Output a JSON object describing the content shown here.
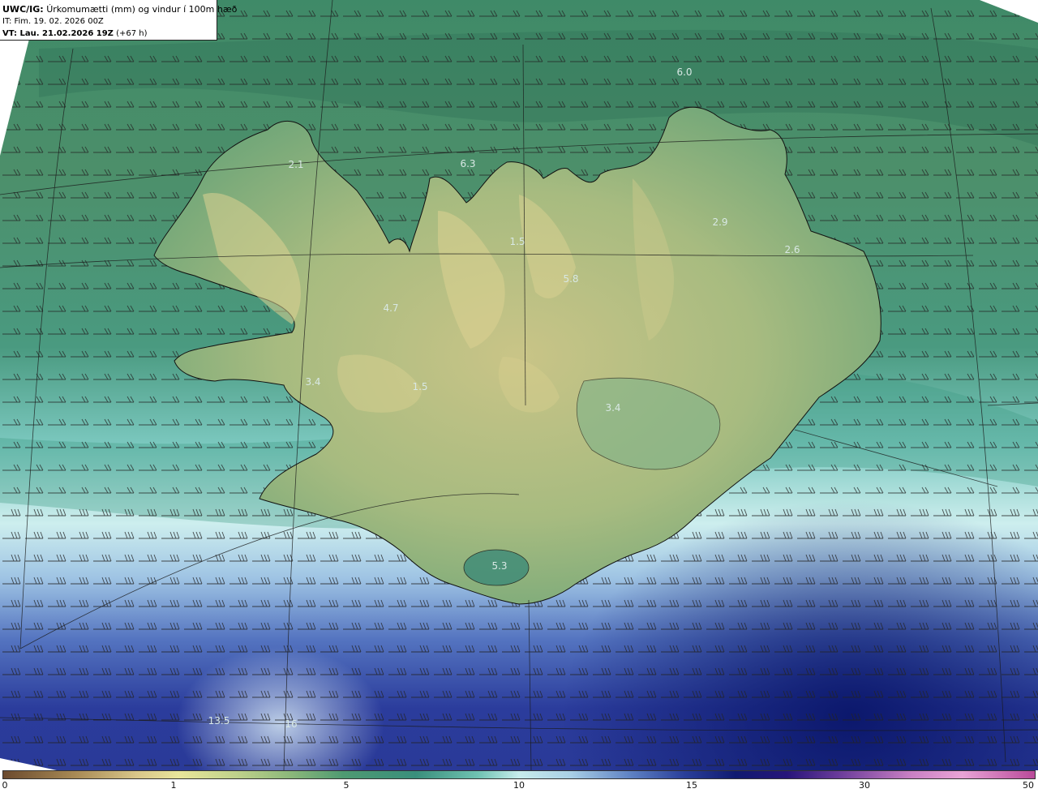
{
  "header": {
    "model": "UWC/IG:",
    "title": "Úrkomumætti (mm) og vindur í 100m hæð",
    "init_time": "IT: Fim. 19. 02. 2026 00Z",
    "valid_time": "VT: Lau. 21.02.2026 19Z",
    "lead_time": "(+67 h)"
  },
  "map_labels": [
    {
      "text": "6.0"
    },
    {
      "text": "2.1"
    },
    {
      "text": "6.3"
    },
    {
      "text": "2.9"
    },
    {
      "text": "2.6"
    },
    {
      "text": "1.5"
    },
    {
      "text": "5.8"
    },
    {
      "text": "4.7"
    },
    {
      "text": "3.4"
    },
    {
      "text": "1.5"
    },
    {
      "text": "3.4"
    },
    {
      "text": "5.3"
    },
    {
      "text": "13.5"
    },
    {
      "text": "16"
    }
  ],
  "colorbar": {
    "ticks": [
      "0",
      "1",
      "5",
      "10",
      "15",
      "30",
      "50"
    ],
    "unit": "mm"
  },
  "colors": {
    "land_high": "#d9d08a",
    "land_mid": "#8fb27a",
    "sea_north": "#3d7d62",
    "sea_coast": "#c4ece9",
    "sea_south": "#2a3a9e",
    "sea_deep": "#0f1a6e",
    "outline": "#111111"
  }
}
